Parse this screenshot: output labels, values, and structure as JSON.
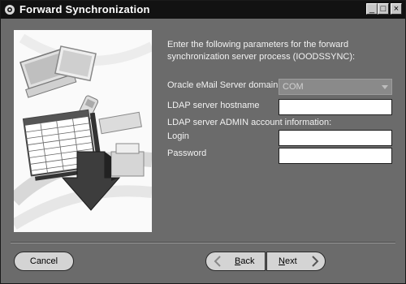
{
  "window": {
    "title": "Forward Synchronization",
    "controls": {
      "minimize": "_",
      "maximize": "□",
      "close": "×"
    }
  },
  "form": {
    "intro": "Enter the following parameters for the forward synchronization server process (IOODSSYNC):",
    "domain_label": "Oracle eMail Server domain",
    "domain_value": "COM",
    "hostname_label": "LDAP server hostname",
    "hostname_value": "",
    "admin_heading": "LDAP server ADMIN account information:",
    "login_label": "Login",
    "login_value": "",
    "password_label": "Password",
    "password_value": ""
  },
  "footer": {
    "cancel": "Cancel",
    "back_first": "B",
    "back_rest": "ack",
    "next_first": "N",
    "next_rest": "ext"
  }
}
